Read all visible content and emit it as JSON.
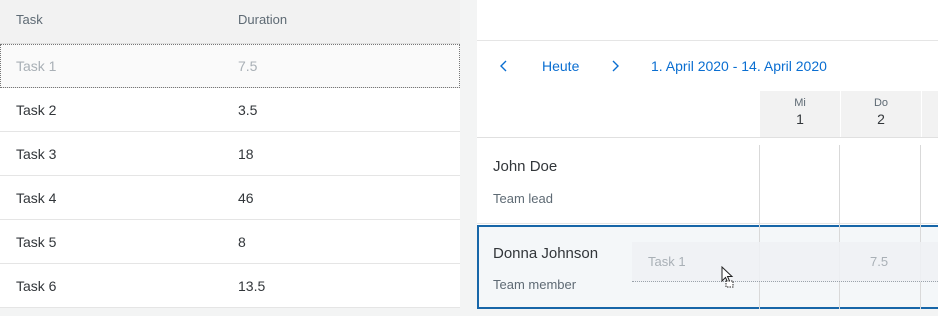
{
  "table": {
    "headers": {
      "task": "Task",
      "duration": "Duration"
    },
    "rows": [
      {
        "task": "Task 1",
        "duration": "7.5"
      },
      {
        "task": "Task 2",
        "duration": "3.5"
      },
      {
        "task": "Task 3",
        "duration": "18"
      },
      {
        "task": "Task 4",
        "duration": "46"
      },
      {
        "task": "Task 5",
        "duration": "8"
      },
      {
        "task": "Task 6",
        "duration": "13.5"
      }
    ]
  },
  "calendar": {
    "nav": {
      "today_label": "Heute",
      "date_range": "1. April 2020 - 14. April 2020"
    },
    "days": [
      {
        "name": "Mi",
        "date": "1"
      },
      {
        "name": "Do",
        "date": "2"
      }
    ],
    "rows": [
      {
        "name": "John Doe",
        "role": "Team lead"
      },
      {
        "name": "Donna Johnson",
        "role": "Team member"
      }
    ],
    "drag_preview": {
      "task": "Task 1",
      "duration": "7.5"
    }
  },
  "colors": {
    "accent": "#0a6ed1",
    "selected_border": "#1766a8",
    "header_bg": "#f2f2f2"
  },
  "icons": {
    "prev": "chevron-left-icon",
    "next": "chevron-right-icon",
    "cursor": "move-cursor-icon"
  }
}
